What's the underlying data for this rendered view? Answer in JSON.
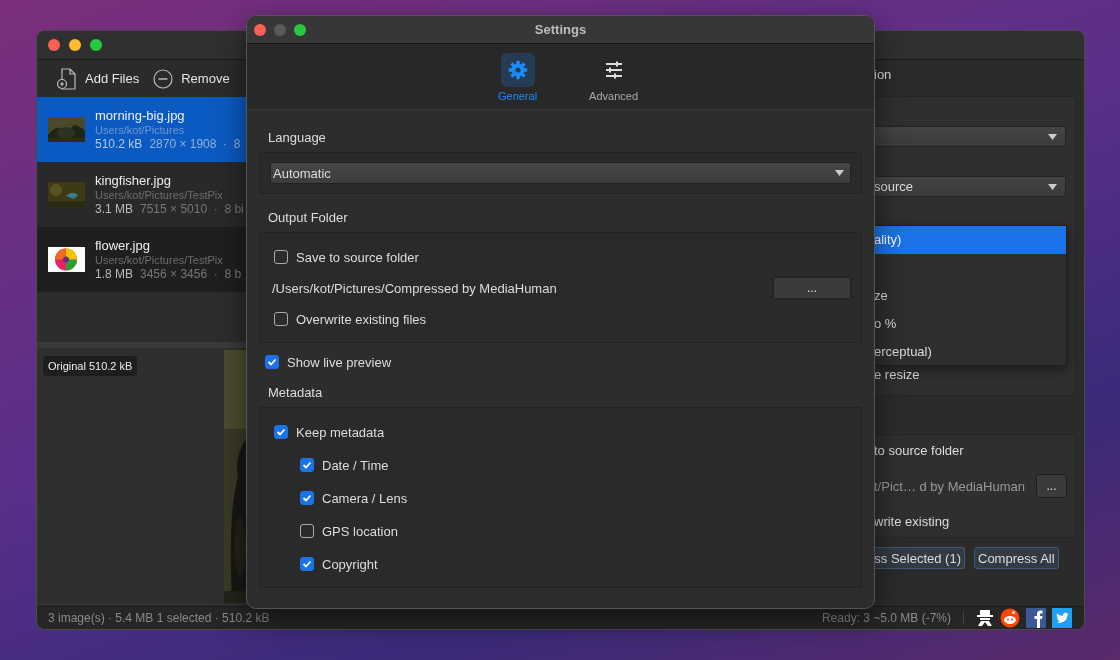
{
  "main_window": {
    "toolbar": [
      {
        "kind": "add",
        "label": "Add Files"
      },
      {
        "kind": "remove",
        "label": "Remove"
      }
    ],
    "files": [
      {
        "name": "morning-big.jpg",
        "path": "Users/kot/Pictures",
        "size": "510.2 kB",
        "details": "2870 × 1908  ·  8",
        "selected": true,
        "kind": "picture"
      },
      {
        "name": "kingfisher.jpg",
        "path": "Users/kot/Pictures/TestPix",
        "size": "3.1 MB",
        "details": "7515 × 5010  ·  8 bi",
        "selected": false,
        "kind": "picture"
      },
      {
        "name": "flower.jpg",
        "path": "Users/kot/Pictures/TestPix",
        "size": "1.8 MB",
        "details": "3456 × 3456  ·  8 b",
        "selected": false,
        "kind": "picture"
      }
    ],
    "preview": {
      "badge": "Original 510.2 kB"
    },
    "right_panel": {
      "heading": "ion",
      "second_select": "source",
      "popup": [
        {
          "label": "ality)",
          "selected": true
        },
        {
          "label": "ze",
          "selected": false
        },
        {
          "label": "o %",
          "selected": false
        },
        {
          "label": "erceptual)",
          "selected": false
        }
      ],
      "resize_label": "e resize",
      "output": {
        "save_label": "to source folder",
        "path": "t/Pict… d by MediaHuman",
        "browse": "...",
        "overwrite_label": "write existing"
      },
      "buttons": [
        "ss Selected (1)",
        "Compress All"
      ]
    },
    "status_bar": {
      "left": "3 image(s) · 5.4 MB 1 selected · 510.2 kB",
      "right": "Ready: 3  ~5.0 MB (-7%)"
    }
  },
  "settings": {
    "title": "Settings",
    "tabs": [
      {
        "kind": "gear",
        "label": "General",
        "selected": true
      },
      {
        "kind": "sliders",
        "label": "Advanced",
        "selected": false
      }
    ],
    "language": {
      "label": "Language",
      "value": "Automatic"
    },
    "output": {
      "label": "Output Folder",
      "save_to_source": {
        "label": "Save to source folder",
        "checked": false
      },
      "path": "/Users/kot/Pictures/Compressed by MediaHuman",
      "browse": "...",
      "overwrite": {
        "label": "Overwrite existing files",
        "checked": false
      }
    },
    "live_preview": {
      "label": "Show live preview",
      "checked": true
    },
    "metadata": {
      "label": "Metadata",
      "keep": {
        "label": "Keep metadata",
        "checked": true
      },
      "children": [
        {
          "label": "Date / Time",
          "checked": true
        },
        {
          "label": "Camera / Lens",
          "checked": true
        },
        {
          "label": "GPS location",
          "checked": false
        },
        {
          "label": "Copyright",
          "checked": true
        }
      ]
    }
  }
}
